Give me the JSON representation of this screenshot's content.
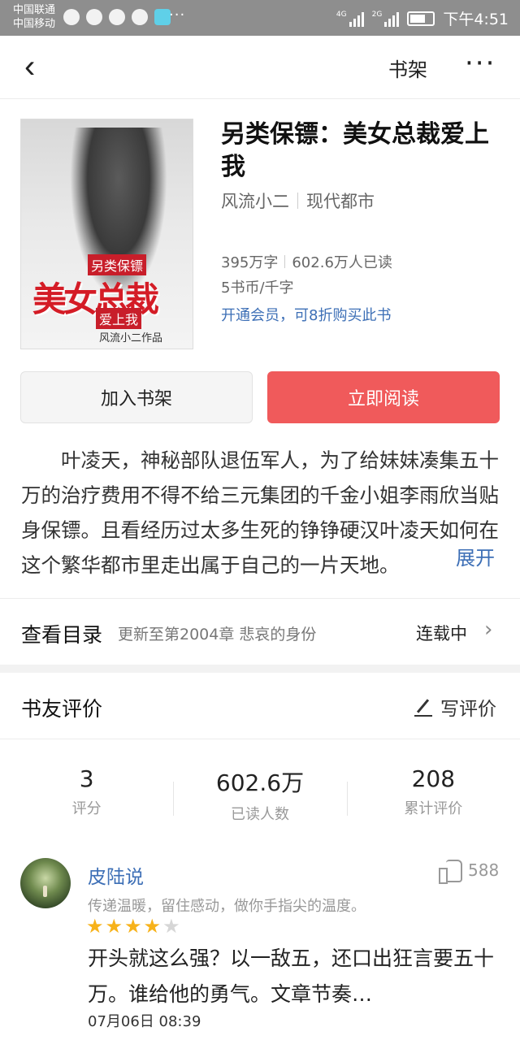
{
  "status_bar": {
    "carrier1": "中国联通",
    "carrier2": "中国移动",
    "dots": "···",
    "net1": "4G",
    "net2": "2G",
    "time": "下午4:51"
  },
  "nav": {
    "shelf_label": "书架",
    "more_label": "···"
  },
  "book": {
    "cover": {
      "line1": "另类保镖",
      "main": "美女总裁",
      "line2": "爱上我",
      "author": "风流小二作品"
    },
    "title": "另类保镖：美女总裁爱上我",
    "author": "风流小二",
    "category": "现代都市",
    "word_count": "395万字",
    "readers": "602.6万人已读",
    "price": "5书币/千字",
    "vip_promo": "开通会员，可8折购买此书"
  },
  "buttons": {
    "add_shelf": "加入书架",
    "read_now": "立即阅读"
  },
  "intro": {
    "text": "叶凌天，神秘部队退伍军人，为了给妹妹凑集五十万的治疗费用不得不给三元集团的千金小姐李雨欣当贴身保镖。且看经历过太多生死的铮铮硬汉叶凌天如何在这个繁华都市里走出属于自己的一片天地。",
    "expand_label": "展开"
  },
  "catalog": {
    "title": "查看目录",
    "update": "更新至第2004章 悲哀的身份",
    "status": "连载中"
  },
  "reviews": {
    "title": "书友评价",
    "write_label": "写评价",
    "stats": [
      {
        "value": "3",
        "label": "评分"
      },
      {
        "value": "602.6万",
        "label": "已读人数"
      },
      {
        "value": "208",
        "label": "累计评价"
      }
    ],
    "items": [
      {
        "user": "皮陆说",
        "likes": "588",
        "signature": "传递温暖，留住感动，做你手指尖的温度。",
        "rating": 4,
        "rating_max": 5,
        "text": "开头就这么强？以一敌五，还口出狂言要五十万。谁给他的勇气。文章节奏…",
        "date": "07月06日 08:39"
      }
    ]
  },
  "colors": {
    "accent_red": "#f05a5b",
    "link_blue": "#3d6fb6",
    "star": "#f7b21a"
  }
}
